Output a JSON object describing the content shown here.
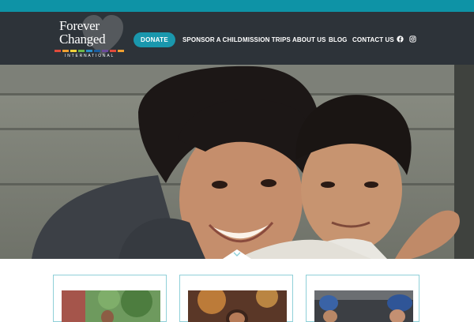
{
  "logo": {
    "line1": "Forever",
    "line2": "Changed",
    "subtitle": "INTERNATIONAL",
    "stripe_colors": [
      "#e04b3b",
      "#f0a030",
      "#f3d23a",
      "#6cb84a",
      "#2a8fc9",
      "#1b5e9e",
      "#6a4a9b",
      "#e04b3b",
      "#f0a030"
    ]
  },
  "header": {
    "donate_label": "DONATE",
    "nav": [
      "SPONSOR A CHILD",
      "MISSION TRIPS",
      "ABOUT US",
      "BLOG",
      "CONTACT US"
    ]
  },
  "icons": {
    "social": [
      "facebook-icon",
      "instagram-icon"
    ],
    "hero_scroll": "chevron-down-icon"
  },
  "colors": {
    "topbar": "#0e93a6",
    "header_bg": "#2d3339",
    "accent": "#1a97ad",
    "card_border": "#8fd0d8"
  }
}
